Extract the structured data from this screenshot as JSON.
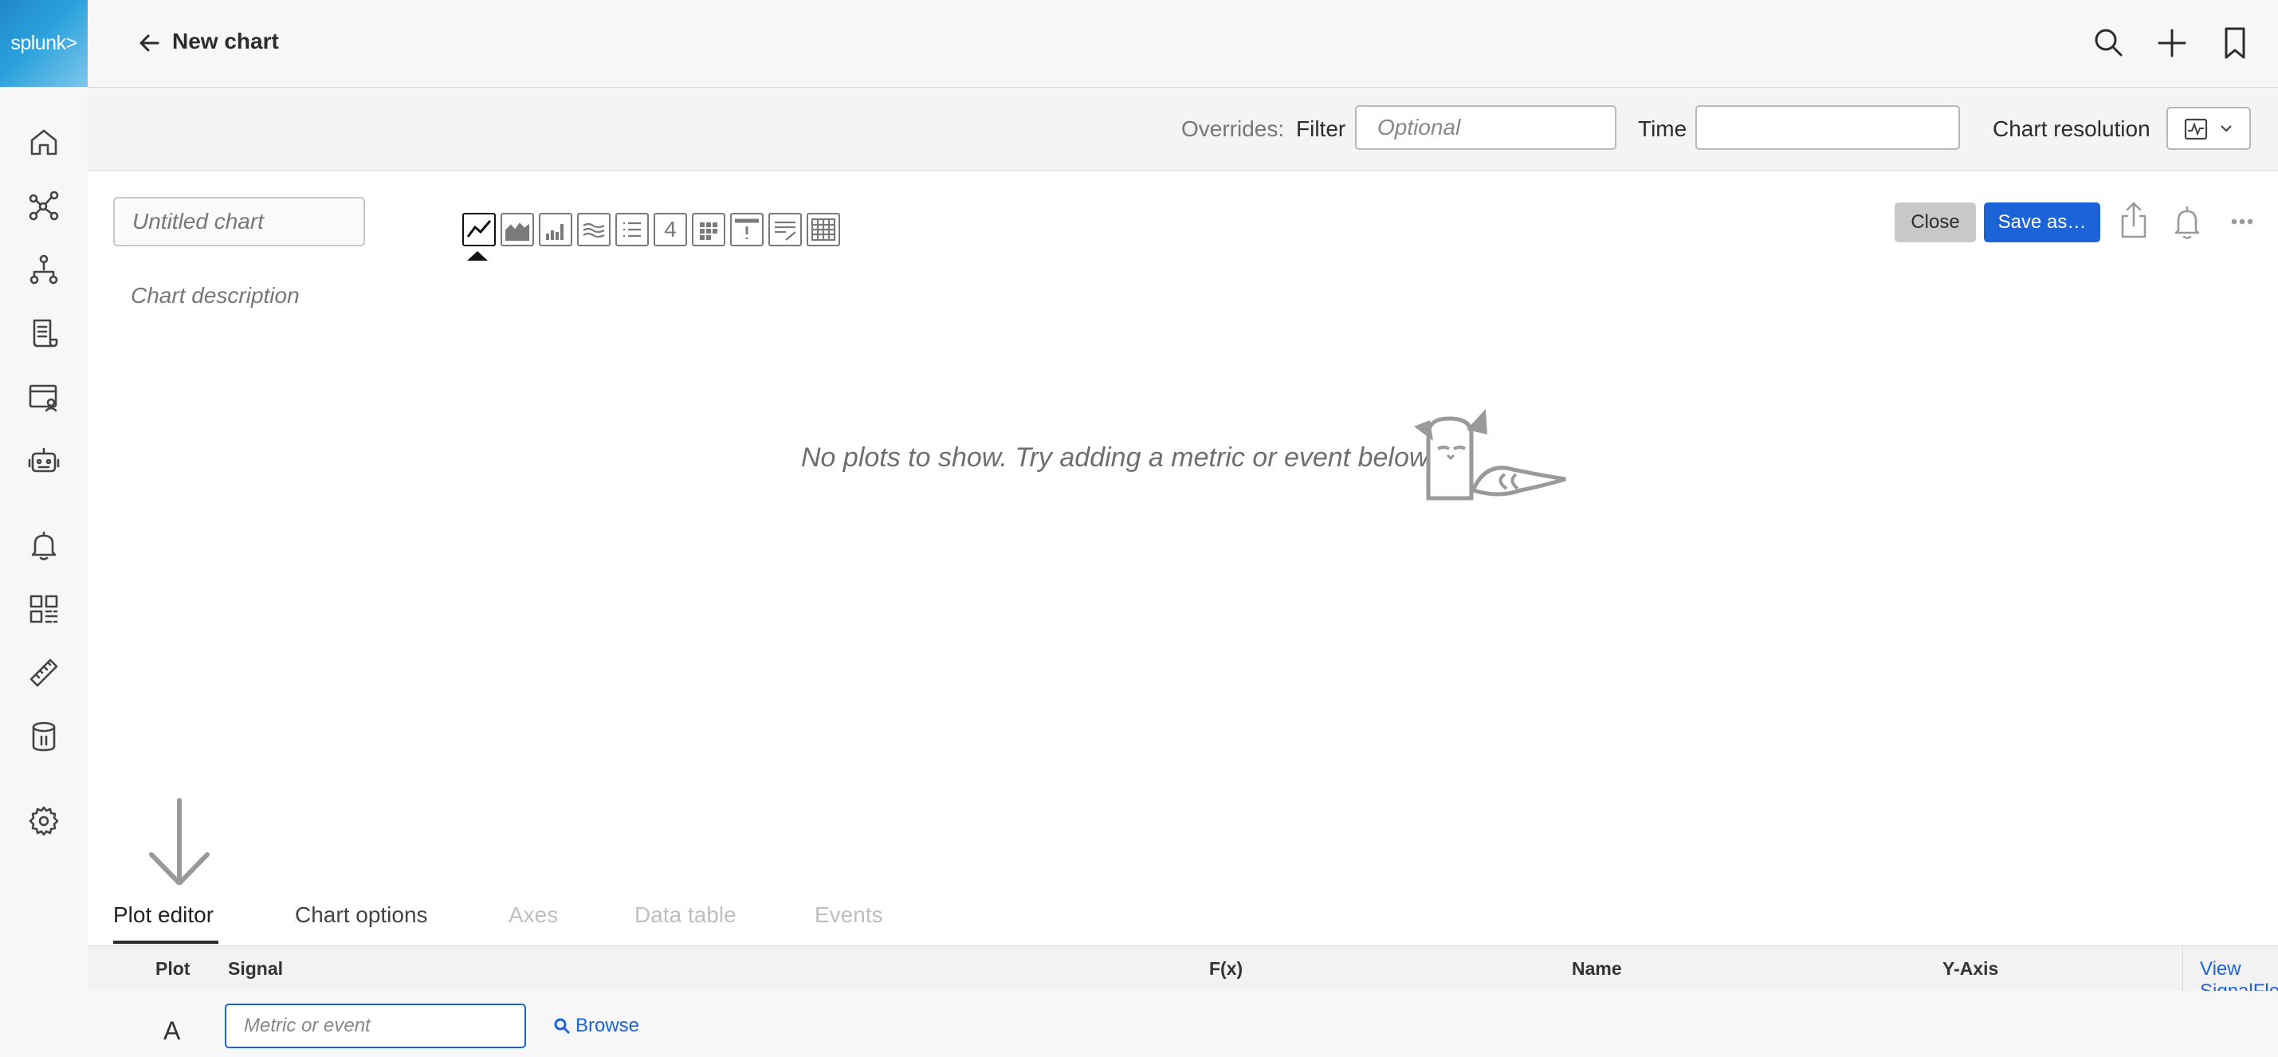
{
  "app": {
    "logo_text": "splunk>"
  },
  "header": {
    "title": "New chart"
  },
  "overrides": {
    "label": "Overrides:",
    "filter_label": "Filter",
    "filter_placeholder": "Optional",
    "time_label": "Time",
    "time_value": "",
    "resolution_label": "Chart resolution"
  },
  "chart": {
    "title_placeholder": "Untitled chart",
    "description_placeholder": "Chart description",
    "selected_type": "line",
    "single_value_glyph": "4",
    "empty_message": "No plots to show. Try adding a metric or event below.",
    "close_label": "Close",
    "save_label": "Save as…"
  },
  "tabs": [
    {
      "label": "Plot editor",
      "state": "active"
    },
    {
      "label": "Chart options",
      "state": "normal"
    },
    {
      "label": "Axes",
      "state": "disabled"
    },
    {
      "label": "Data table",
      "state": "disabled"
    },
    {
      "label": "Events",
      "state": "disabled"
    }
  ],
  "plot_table": {
    "columns": {
      "plot": "Plot",
      "signal": "Signal",
      "fx": "F(x)",
      "name": "Name",
      "yaxis": "Y-Axis"
    },
    "view_signalflow": "View SignalFlow",
    "rows": [
      {
        "letter": "A",
        "signal_placeholder": "Metric or event",
        "browse_label": "Browse"
      }
    ]
  },
  "colors": {
    "accent": "#1d63d8",
    "logo": "#2a97d6",
    "close_bg": "#c8c8c8"
  }
}
